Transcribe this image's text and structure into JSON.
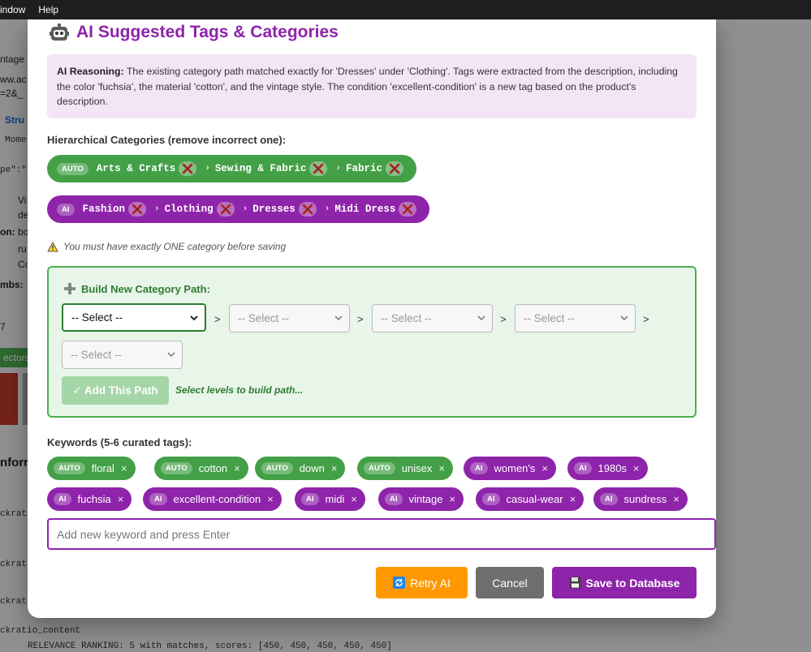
{
  "menubar": {
    "items": [
      "indow",
      "Help"
    ]
  },
  "background": {
    "lines": [
      "ntage",
      "ww.ac",
      "=2&_",
      "Stru",
      "Mome",
      "pe\":\"",
      "Vi",
      "de",
      "on:",
      "bo",
      "ru",
      "Co",
      "mbs:",
      "7",
      "ectors",
      "nforr",
      "ckrati",
      "ckrati",
      "ckrati",
      "ckratio_content",
      "RELEVANCE RANKING: 5 with matches, scores: [450, 450, 450, 450, 450]"
    ]
  },
  "modal": {
    "title": "AI Suggested Tags & Categories",
    "reasoning_label": "AI Reasoning:",
    "reasoning_text": "The existing category path matched exactly for 'Dresses' under 'Clothing'. Tags were extracted from the description, including the color 'fuchsia', the material 'cotton', and the vintage style. The condition 'excellent-condition' is a new tag based on the product's description.",
    "categories_label": "Hierarchical Categories (remove incorrect one):",
    "category_paths": [
      {
        "source": "AUTO",
        "nodes": [
          "Arts & Crafts",
          "Sewing & Fabric",
          "Fabric"
        ]
      },
      {
        "source": "AI",
        "nodes": [
          "Fashion",
          "Clothing",
          "Dresses",
          "Midi Dress"
        ]
      }
    ],
    "warning": "You must have exactly ONE category before saving",
    "builder": {
      "title": "Build New Category Path:",
      "select_placeholder": "-- Select --",
      "separator": ">",
      "add_button": "✓ Add This Path",
      "hint": "Select levels to build path..."
    },
    "keywords_label": "Keywords (5-6 curated tags):",
    "keywords": [
      {
        "source": "AUTO",
        "text": "floral"
      },
      {
        "source": "AUTO",
        "text": "cotton"
      },
      {
        "source": "AUTO",
        "text": "down"
      },
      {
        "source": "AUTO",
        "text": "unisex"
      },
      {
        "source": "AI",
        "text": "women's"
      },
      {
        "source": "AI",
        "text": "1980s"
      },
      {
        "source": "AI",
        "text": "fuchsia"
      },
      {
        "source": "AI",
        "text": "excellent-condition"
      },
      {
        "source": "AI",
        "text": "midi"
      },
      {
        "source": "AI",
        "text": "vintage"
      },
      {
        "source": "AI",
        "text": "casual-wear"
      },
      {
        "source": "AI",
        "text": "sundress"
      }
    ],
    "keyword_input_placeholder": "Add new keyword and press Enter",
    "buttons": {
      "retry": "Retry AI",
      "cancel": "Cancel",
      "save": "Save to Database"
    }
  },
  "colors": {
    "ai_purple": "#8e24aa",
    "auto_green": "#43a047",
    "retry_orange": "#ff9800",
    "cancel_gray": "#6e6e6e",
    "builder_bg": "#e8f5e9",
    "reasoning_bg": "#f3e5f5"
  }
}
